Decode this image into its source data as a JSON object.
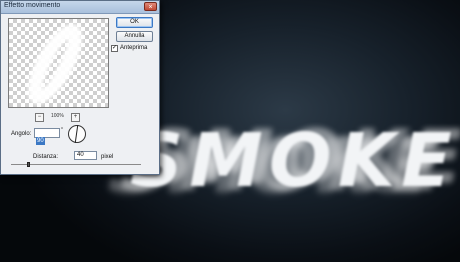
{
  "canvas": {
    "text": "SMOKE"
  },
  "dialog": {
    "title": "Effetto movimento",
    "close_label": "×",
    "ok_label": "OK",
    "cancel_label": "Annulla",
    "preview_checked": true,
    "preview_check_mark": "✓",
    "preview_label": "Anteprima",
    "zoom_out_label": "−",
    "zoom_in_label": "+",
    "zoom_value": "100%",
    "angle_label": "Angolo:",
    "angle_value": "90",
    "angle_unit": "°",
    "distance_label": "Distanza:",
    "distance_value": "40",
    "distance_unit": "pixel",
    "distance_slider_fraction": 0.13
  }
}
